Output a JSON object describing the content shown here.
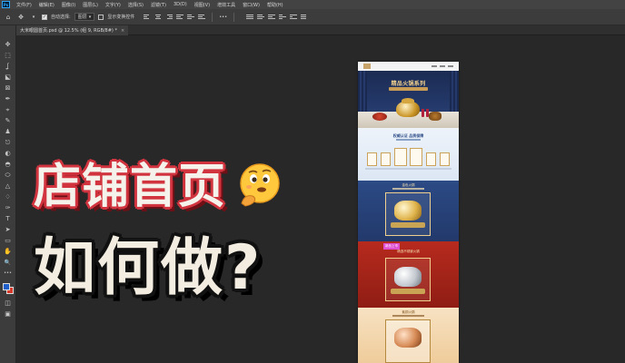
{
  "app": {
    "logo": "Ps",
    "menu": [
      "文件(F)",
      "编辑(E)",
      "图像(I)",
      "图层(L)",
      "文字(Y)",
      "选择(S)",
      "滤镜(T)",
      "3D(D)",
      "视图(V)",
      "增效工具",
      "窗口(W)",
      "帮助(H)"
    ]
  },
  "options": {
    "auto_select_label": "自动选择:",
    "auto_select_value": "图层",
    "show_transform_label": "显示变换控件",
    "more": "•••"
  },
  "document_tab": {
    "title": "大米眼圆首页.psd @ 12.5% (组 9, RGB/8#) *",
    "close": "×"
  },
  "tools": [
    "✥",
    "⬚",
    "ʆ",
    "⬕",
    "⊠",
    "✒",
    "⌖",
    "✎",
    "♟",
    "⎋",
    "◐",
    "◓",
    "⬭",
    "△",
    "♢",
    "✑",
    "T",
    "➤",
    "▭",
    "✋",
    "🔍",
    "•••"
  ],
  "colors": {
    "foreground": "#1f5fc9",
    "background": "#d73a2a",
    "overlay_red": "#d2343f"
  },
  "design": {
    "banner_title": "精品火锅系列",
    "cert_title": "权威认证 品质保障",
    "blue_title": "金色火锅",
    "red_tag": "新品上市",
    "red_title": "精选不锈钢火锅",
    "cream_title": "紫铜火锅"
  },
  "overlay": {
    "line1": "店铺首页",
    "line2": "如何做?"
  }
}
